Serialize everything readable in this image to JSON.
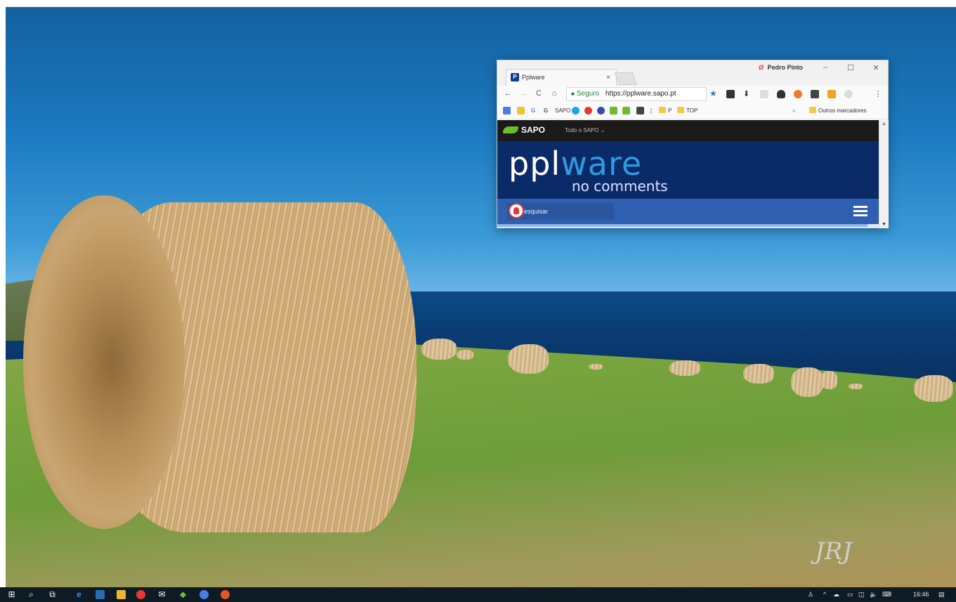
{
  "browser": {
    "tab_title": "Pplware",
    "tab_favicon": "P",
    "tab_close": "×",
    "profile_name": "Pedro Pinto",
    "profile_icon": "Ø",
    "window_controls": {
      "minimize": "–",
      "maximize": "☐",
      "close": "✕"
    },
    "nav": {
      "back": "←",
      "forward": "→",
      "reload": "C",
      "home": "⌂"
    },
    "omnibox": {
      "secure_label": "Seguro",
      "url": "https://pplware.sapo.pt"
    },
    "star": "★",
    "bookmarks": [
      "SAPO",
      "P",
      "TOP"
    ],
    "overflow": "»",
    "other_bookmarks": "Outros marcadores",
    "extensions_menu": "⋮"
  },
  "page": {
    "sapo_logo": "SAPO",
    "sapo_link": "Todo o SAPO",
    "pplware_logo_a": "ppl",
    "pplware_logo_b": "ware",
    "tagline": "no comments",
    "search_placeholder": "Pesquisar",
    "load_progress": 0.97
  },
  "desktop": {
    "signature": "JRJ"
  },
  "taskbar": {
    "clock": "16:46"
  },
  "colors": {
    "pplware_blue": "#0b2a68",
    "nav_blue": "#2f5fb0",
    "sapo_green": "#6dbb2e",
    "taskbar": "#0e1a24"
  }
}
